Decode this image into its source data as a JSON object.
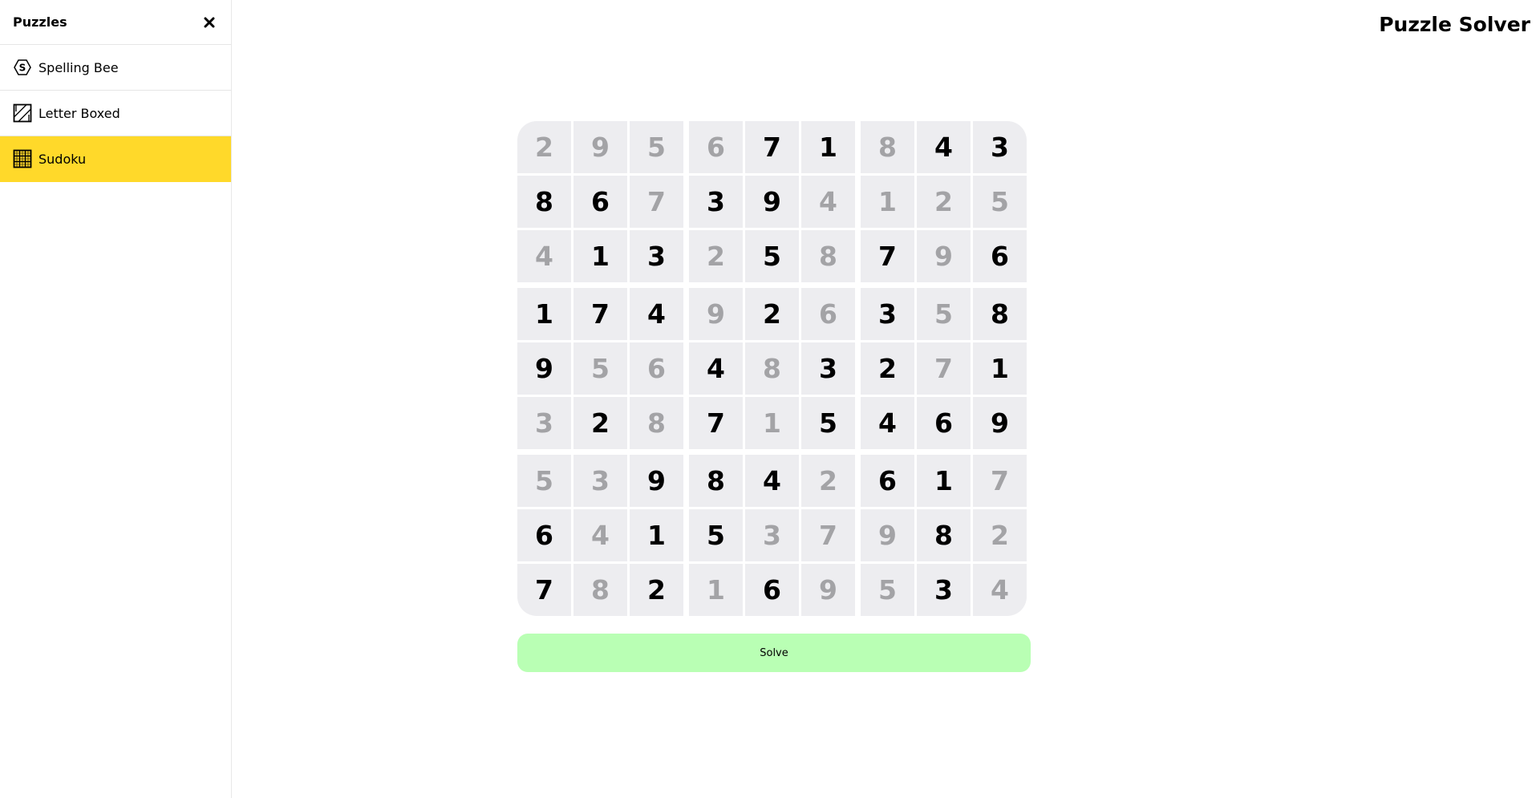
{
  "sidebar": {
    "title": "Puzzles",
    "close_icon": "close-icon",
    "items": [
      {
        "label": "Spelling Bee",
        "icon": "spelling-bee-hexagon-icon",
        "active": false
      },
      {
        "label": "Letter Boxed",
        "icon": "letter-boxed-icon",
        "active": false
      },
      {
        "label": "Sudoku",
        "icon": "sudoku-grid-icon",
        "active": true
      }
    ]
  },
  "header": {
    "title": "Puzzle Solver"
  },
  "sudoku": {
    "grid": [
      [
        2,
        9,
        5,
        6,
        7,
        1,
        8,
        4,
        3
      ],
      [
        8,
        6,
        7,
        3,
        9,
        4,
        1,
        2,
        5
      ],
      [
        4,
        1,
        3,
        2,
        5,
        8,
        7,
        9,
        6
      ],
      [
        1,
        7,
        4,
        9,
        2,
        6,
        3,
        5,
        8
      ],
      [
        9,
        5,
        6,
        4,
        8,
        3,
        2,
        7,
        1
      ],
      [
        3,
        2,
        8,
        7,
        1,
        5,
        4,
        6,
        9
      ],
      [
        5,
        3,
        9,
        8,
        4,
        2,
        6,
        1,
        7
      ],
      [
        6,
        4,
        1,
        5,
        3,
        7,
        9,
        8,
        2
      ],
      [
        7,
        8,
        2,
        1,
        6,
        9,
        5,
        3,
        4
      ]
    ],
    "given": [
      [
        0,
        0,
        0,
        0,
        1,
        1,
        0,
        1,
        1
      ],
      [
        1,
        1,
        0,
        1,
        1,
        0,
        0,
        0,
        0
      ],
      [
        0,
        1,
        1,
        0,
        1,
        0,
        1,
        0,
        1
      ],
      [
        1,
        1,
        1,
        0,
        1,
        0,
        1,
        0,
        1
      ],
      [
        1,
        0,
        0,
        1,
        0,
        1,
        1,
        0,
        1
      ],
      [
        0,
        1,
        0,
        1,
        0,
        1,
        1,
        1,
        1
      ],
      [
        0,
        0,
        1,
        1,
        1,
        0,
        1,
        1,
        0
      ],
      [
        1,
        0,
        1,
        1,
        0,
        0,
        0,
        1,
        0
      ],
      [
        1,
        0,
        1,
        0,
        1,
        0,
        0,
        1,
        0
      ]
    ],
    "colors": {
      "cell_background": "#ededf0",
      "given_digit": "#000000",
      "solved_digit": "#a3a3a6"
    }
  },
  "actions": {
    "solve_label": "Solve"
  },
  "colors": {
    "active_nav": "#ffd92a",
    "solve_button": "#b9ffb4"
  }
}
